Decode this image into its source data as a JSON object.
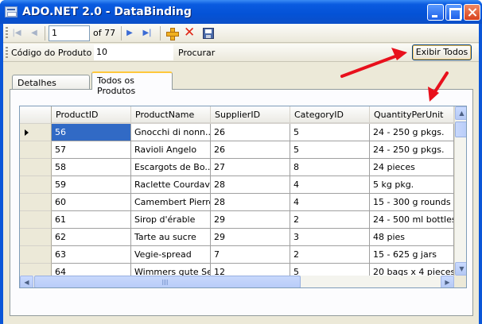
{
  "window": {
    "title": "ADO.NET 2.0 - DataBinding"
  },
  "navigator": {
    "position": "1",
    "count_label": "of 77"
  },
  "search": {
    "label": "Código do Produto ::",
    "value": "10",
    "search_label": "Procurar",
    "show_all_label": "Exibir Todos"
  },
  "tabs": [
    {
      "label": "Detalhes Produtos"
    },
    {
      "label": "Todos os Produtos"
    }
  ],
  "grid": {
    "columns": [
      "ProductID",
      "ProductName",
      "SupplierID",
      "CategoryID",
      "QuantityPerUnit"
    ],
    "rows": [
      [
        "56",
        "Gnocchi di nonn...",
        "26",
        "5",
        "24 - 250 g pkgs."
      ],
      [
        "57",
        "Ravioli Angelo",
        "26",
        "5",
        "24 - 250 g pkgs."
      ],
      [
        "58",
        "Escargots de Bo...",
        "27",
        "8",
        "24 pieces"
      ],
      [
        "59",
        "Raclette Courdav...",
        "28",
        "4",
        "5 kg pkg."
      ],
      [
        "60",
        "Camembert Pierrot",
        "28",
        "4",
        "15 - 300 g rounds"
      ],
      [
        "61",
        "Sirop d'érable",
        "29",
        "2",
        "24 - 500 ml bottles"
      ],
      [
        "62",
        "Tarte au sucre",
        "29",
        "3",
        "48 pies"
      ],
      [
        "63",
        "Vegie-spread",
        "7",
        "2",
        "15 - 625 g jars"
      ],
      [
        "64",
        "Wimmers gute Se...",
        "12",
        "5",
        "20 bags x 4 pieces"
      ]
    ]
  }
}
